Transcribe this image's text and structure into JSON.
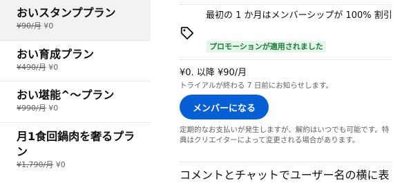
{
  "plans": [
    {
      "name": "おいスタンププラン",
      "old_price": "¥90/月",
      "new_price": "¥0",
      "selected": true
    },
    {
      "name": "おい育成プラン",
      "old_price": "¥490/月",
      "new_price": "¥0",
      "selected": false
    },
    {
      "name": "おい堪能^〜プラン",
      "old_price": "¥990/月",
      "new_price": "¥0",
      "selected": false
    },
    {
      "name": "月1食回鍋肉を奢るプラン",
      "old_price": "¥1,790/月",
      "new_price": "¥0",
      "selected": false
    }
  ],
  "promo": {
    "icon": "tag-icon",
    "text": "最初の 1 か月はメンバーシップが 100% 割引",
    "badge": "プロモーションが適用されました",
    "badge_color": "#188038",
    "badge_bg": "#e6f4ea"
  },
  "pricing": {
    "price_line": "¥0. 以降 ¥90/月",
    "trial_note": "トライアルが終わる 7 日前にお知らせします。"
  },
  "join_button": {
    "label": "メンバーになる",
    "color": "#065fd4"
  },
  "billing_note": "定期的なお支払いが発生しますが、解約はいつでも可能です。特典はクリエイターによって変更される場合があります。",
  "next_section": {
    "heading": "コメントとチャットでユーザー名の横に表"
  }
}
